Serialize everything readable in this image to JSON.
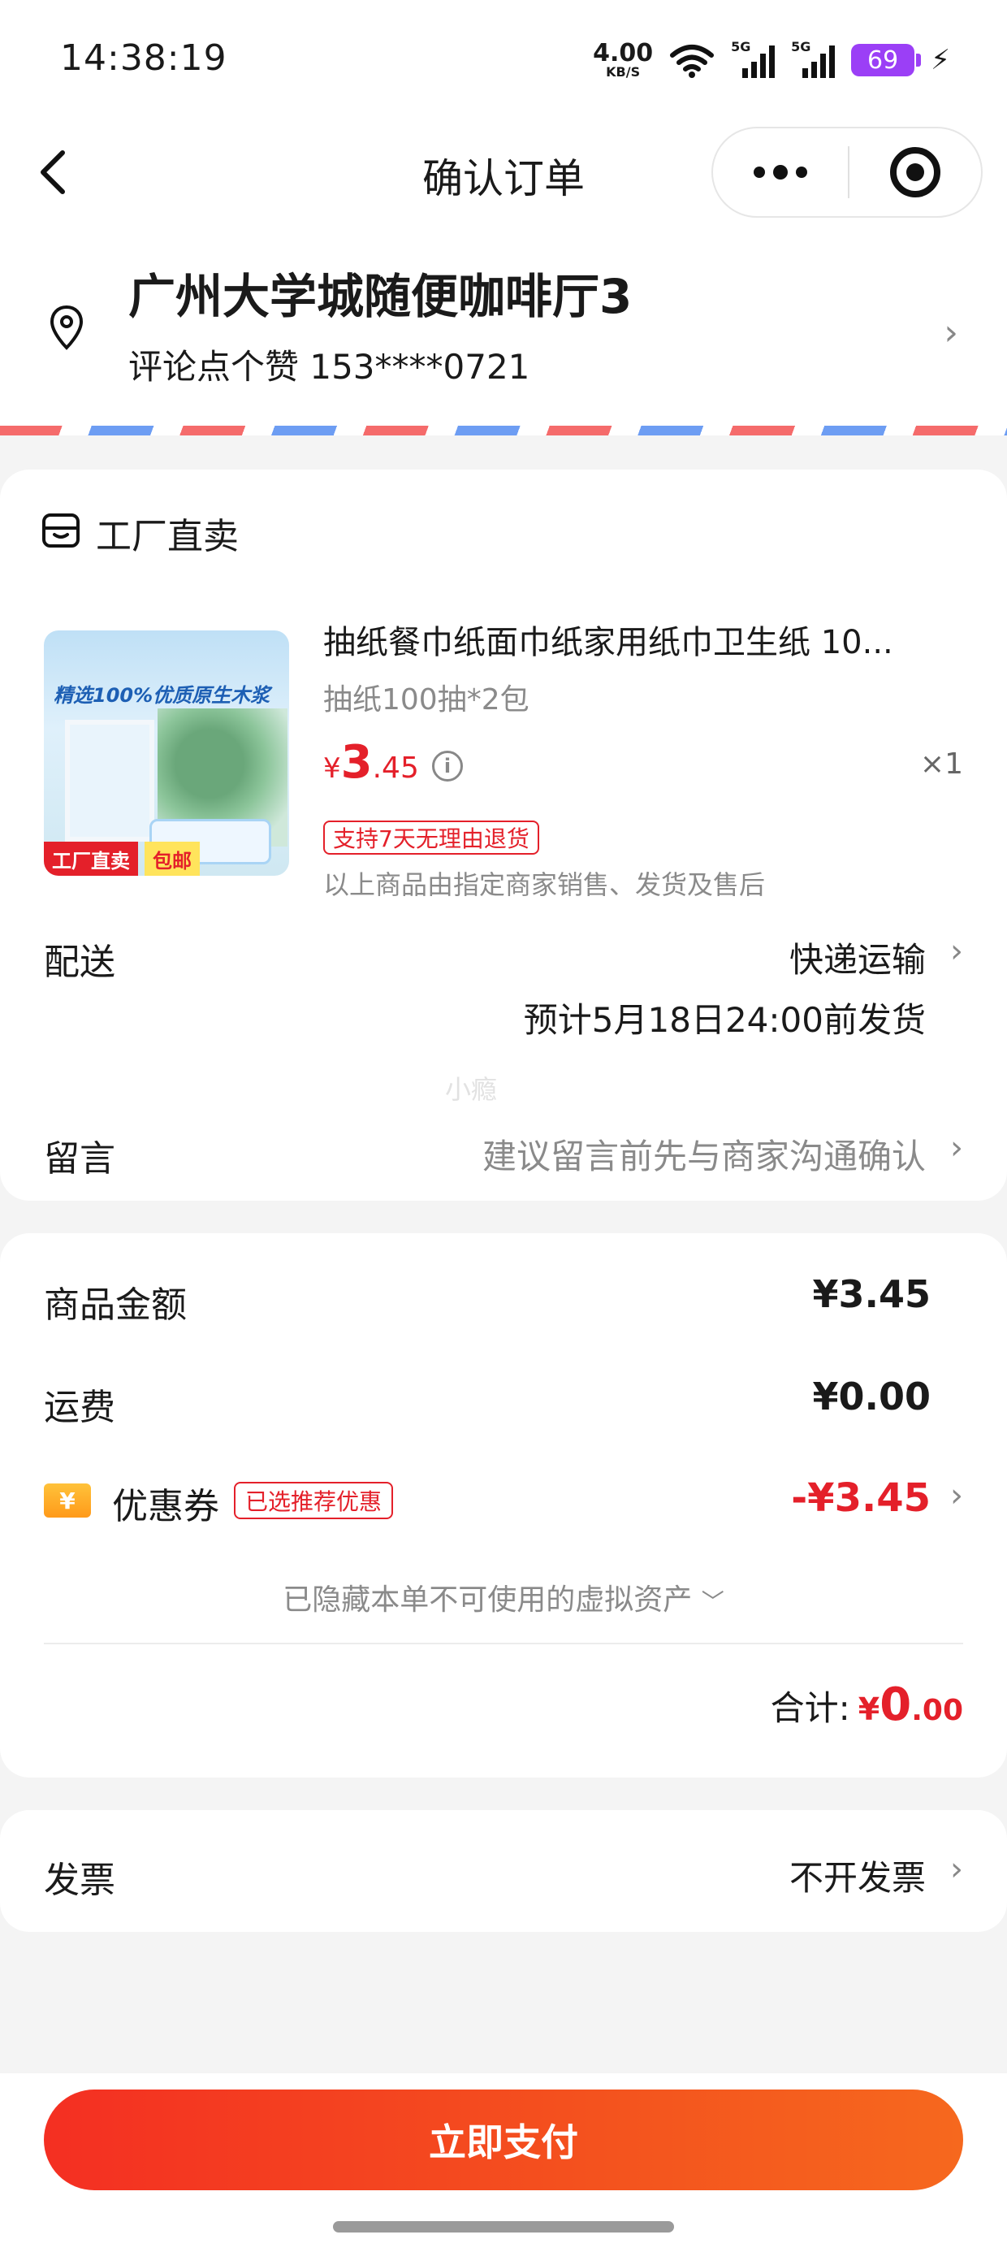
{
  "status_bar": {
    "time": "14:38:19",
    "net_speed_value": "4.00",
    "net_speed_unit": "KB/S",
    "signal1_label": "5G",
    "signal2_label": "5G",
    "battery": "69",
    "icons": [
      "wifi-icon",
      "signal-icon",
      "signal-icon",
      "battery-icon",
      "charging-icon"
    ]
  },
  "nav": {
    "title": "确认订单"
  },
  "address": {
    "name": "广州大学城随便咖啡厅3",
    "contact": "评论点个赞 153****0721"
  },
  "shop": {
    "name": "工厂直卖"
  },
  "product": {
    "image_caption": "精选100%优质原生木浆",
    "image_tag_left": "工厂直卖",
    "image_tag_right": "包邮",
    "title": "抽纸餐巾纸面巾纸家用纸巾卫生纸 10...",
    "spec": "抽纸100抽*2包",
    "price_currency": "¥",
    "price_int": "3",
    "price_dec": ".45",
    "quantity": "×1",
    "return_badge": "支持7天无理由退货",
    "seller_note": "以上商品由指定商家销售、发货及售后"
  },
  "delivery": {
    "label": "配送",
    "method": "快递运输",
    "estimate": "预计5月18日24:00前发货"
  },
  "watermark": "小瘾",
  "message": {
    "label": "留言",
    "placeholder": "建议留言前先与商家沟通确认"
  },
  "summary": {
    "goods_label": "商品金额",
    "goods_amount": "¥3.45",
    "shipping_label": "运费",
    "shipping_amount": "¥0.00",
    "coupon_icon": "¥",
    "coupon_label": "优惠券",
    "coupon_badge": "已选推荐优惠",
    "coupon_amount": "-¥3.45",
    "hidden_assets": "已隐藏本单不可使用的虚拟资产",
    "total_label": "合计:",
    "total_currency": "¥",
    "total_int": "0",
    "total_dec": ".00"
  },
  "invoice": {
    "label": "发票",
    "value": "不开发票"
  },
  "pay_button": "立即支付",
  "colors": {
    "accent_red": "#e4202a",
    "pay_gradient_start": "#f42f22",
    "pay_gradient_end": "#f6681e",
    "battery": "#9b3ff6"
  }
}
